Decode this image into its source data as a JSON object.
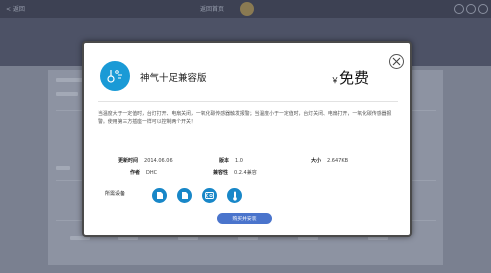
{
  "topbar": {
    "back_label": "< 返回",
    "center_text": "返回首页"
  },
  "app": {
    "name": "神气十足兼容版",
    "price_currency": "￥",
    "price_value": "免费",
    "description": "当温度大于一定值时，台灯打开、电扇关闭，一氧化碳传感器触发报警；当温度小于一定值时，台灯关闭、电扇打开，一氧化碳传感器报警。使用第三方插座一样可以控制两个开关！",
    "meta": {
      "update_time_label": "更新时间",
      "update_time": "2014.06.06",
      "version_label": "版本",
      "version": "1.0",
      "size_label": "大小",
      "size": "2.647KB",
      "author_label": "作者",
      "author": "DHC",
      "compat_label": "兼容性",
      "compat": "0.2.4兼容"
    },
    "devices_label": "所需设备",
    "buy_label": "购买并安装"
  },
  "icons": {
    "close": "close-icon",
    "app": "sensor-app-icon",
    "devices": [
      "socket-icon",
      "socket-icon",
      "co-sensor-icon",
      "thermometer-icon"
    ]
  },
  "colors": {
    "accent": "#1a9ad6",
    "device_icon": "#1887c8",
    "buy_button": "#4a74cc",
    "overlay": "#6f7688"
  }
}
